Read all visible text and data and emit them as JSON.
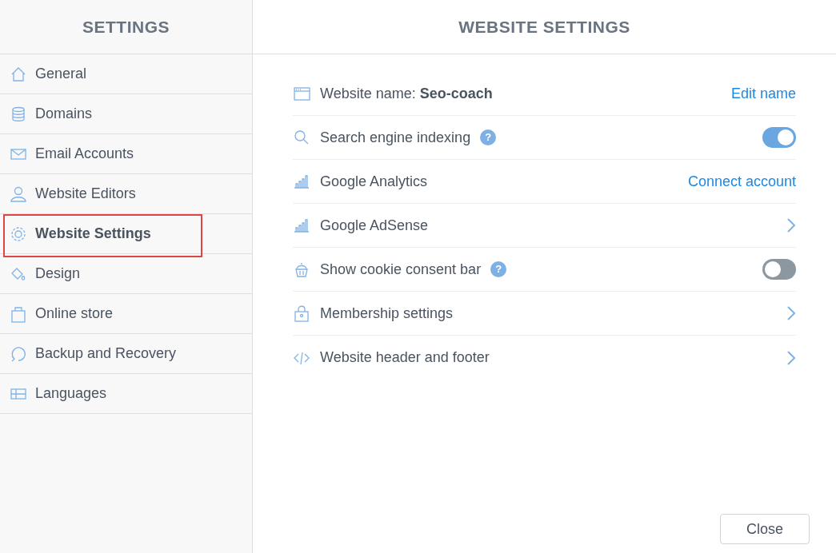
{
  "sidebar": {
    "title": "SETTINGS",
    "items": [
      {
        "label": "General",
        "selected": false
      },
      {
        "label": "Domains",
        "selected": false
      },
      {
        "label": "Email Accounts",
        "selected": false
      },
      {
        "label": "Website Editors",
        "selected": false
      },
      {
        "label": "Website Settings",
        "selected": true
      },
      {
        "label": "Design",
        "selected": false
      },
      {
        "label": "Online store",
        "selected": false
      },
      {
        "label": "Backup and Recovery",
        "selected": false
      },
      {
        "label": "Languages",
        "selected": false
      }
    ]
  },
  "main": {
    "title": "WEBSITE SETTINGS",
    "rows": [
      {
        "kind": "link",
        "label": "Website name: **Seo-coach**",
        "action": "Edit name"
      },
      {
        "kind": "toggle",
        "label": "Search engine indexing",
        "help": "?",
        "on": true
      },
      {
        "kind": "link",
        "label": "Google Analytics",
        "action": "Connect account"
      },
      {
        "kind": "chevron",
        "label": "Google AdSense"
      },
      {
        "kind": "toggle",
        "label": "Show cookie consent bar",
        "help": "?",
        "on": false
      },
      {
        "kind": "chevron",
        "label": "Membership settings"
      },
      {
        "kind": "chevron",
        "label": "Website header and footer"
      }
    ],
    "close_button": "Close"
  }
}
